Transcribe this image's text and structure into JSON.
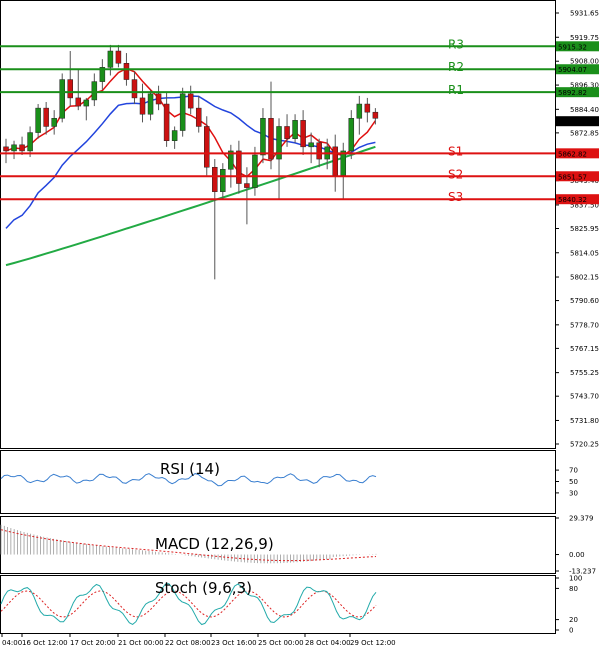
{
  "colors": {
    "resistance": "#1a8f1a",
    "support": "#dd1111",
    "bull_candle": "#1a8f1a",
    "bear_candle": "#cc1111",
    "ma_fast": "#e01010",
    "ma_mid": "#2244dd",
    "ma_slow": "#22aa44",
    "rsi": "#3a7fd0",
    "macd_signal": "#dd2222",
    "stoch_main": "#22aaaa",
    "stoch_signal": "#dd2222"
  },
  "price_axis": {
    "ylim": [
      5720.25,
      5931.65
    ],
    "ticks": [
      "5931.65",
      "5919.75",
      "5908.00",
      "5896.30",
      "5884.40",
      "5872.85",
      "5849.40",
      "5837.50",
      "5825.95",
      "5814.05",
      "5802.15",
      "5790.60",
      "5778.70",
      "5767.15",
      "5755.25",
      "5743.70",
      "5731.80",
      "5720.25"
    ],
    "tick_values": [
      5931.65,
      5919.75,
      5908.0,
      5896.3,
      5884.4,
      5872.85,
      5849.4,
      5837.5,
      5825.95,
      5814.05,
      5802.15,
      5790.6,
      5778.7,
      5767.15,
      5755.25,
      5743.7,
      5731.8,
      5720.25
    ],
    "current_price": "5878.58"
  },
  "levels": [
    {
      "name": "R3",
      "value": 5915.32,
      "tag": "5915.32",
      "kind": "resistance"
    },
    {
      "name": "R2",
      "value": 5904.07,
      "tag": "5904.07",
      "kind": "resistance"
    },
    {
      "name": "R1",
      "value": 5892.82,
      "tag": "5892.82",
      "kind": "resistance"
    },
    {
      "name": "S1",
      "value": 5862.82,
      "tag": "5862.82",
      "kind": "support"
    },
    {
      "name": "S2",
      "value": 5851.57,
      "tag": "5851.57",
      "kind": "support"
    },
    {
      "name": "S3",
      "value": 5840.32,
      "tag": "5840.32",
      "kind": "support"
    }
  ],
  "time_axis": [
    "04:00",
    "16 Oct 12:00",
    "17 Oct 20:00",
    "21 Oct 00:00",
    "22 Oct 08:00",
    "23 Oct 16:00",
    "25 Oct 00:00",
    "28 Oct 04:00",
    "29 Oct 12:00"
  ],
  "chart_data": {
    "type": "candlestick",
    "candles": [
      [
        5866,
        5870,
        5858,
        5864
      ],
      [
        5864,
        5869,
        5860,
        5867
      ],
      [
        5867,
        5871,
        5862,
        5864
      ],
      [
        5864,
        5876,
        5861,
        5873
      ],
      [
        5873,
        5887,
        5870,
        5885
      ],
      [
        5885,
        5888,
        5872,
        5876
      ],
      [
        5876,
        5884,
        5872,
        5880
      ],
      [
        5880,
        5902,
        5878,
        5899
      ],
      [
        5899,
        5913,
        5886,
        5890
      ],
      [
        5890,
        5904,
        5884,
        5886
      ],
      [
        5886,
        5890,
        5879,
        5889
      ],
      [
        5889,
        5902,
        5886,
        5898
      ],
      [
        5898,
        5909,
        5894,
        5905
      ],
      [
        5905,
        5916,
        5901,
        5913
      ],
      [
        5913,
        5916,
        5905,
        5907
      ],
      [
        5907,
        5912,
        5896,
        5899
      ],
      [
        5899,
        5903,
        5887,
        5890
      ],
      [
        5890,
        5897,
        5878,
        5882
      ],
      [
        5882,
        5894,
        5879,
        5892
      ],
      [
        5892,
        5896,
        5884,
        5887
      ],
      [
        5887,
        5893,
        5866,
        5869
      ],
      [
        5869,
        5876,
        5865,
        5874
      ],
      [
        5874,
        5895,
        5871,
        5892
      ],
      [
        5892,
        5896,
        5882,
        5885
      ],
      [
        5885,
        5891,
        5873,
        5876
      ],
      [
        5876,
        5881,
        5852,
        5856
      ],
      [
        5856,
        5860,
        5801,
        5844
      ],
      [
        5844,
        5858,
        5840,
        5855
      ],
      [
        5855,
        5867,
        5846,
        5864
      ],
      [
        5864,
        5869,
        5843,
        5848
      ],
      [
        5848,
        5856,
        5828,
        5846
      ],
      [
        5846,
        5866,
        5842,
        5862
      ],
      [
        5862,
        5885,
        5858,
        5880
      ],
      [
        5880,
        5898,
        5855,
        5860
      ],
      [
        5860,
        5880,
        5840,
        5876
      ],
      [
        5876,
        5882,
        5866,
        5870
      ],
      [
        5870,
        5882,
        5868,
        5879
      ],
      [
        5879,
        5884,
        5862,
        5866
      ],
      [
        5866,
        5873,
        5858,
        5868
      ],
      [
        5868,
        5870,
        5856,
        5860
      ],
      [
        5860,
        5870,
        5855,
        5866
      ],
      [
        5866,
        5872,
        5844,
        5852
      ],
      [
        5852,
        5868,
        5840,
        5864
      ],
      [
        5864,
        5884,
        5860,
        5880
      ],
      [
        5880,
        5891,
        5872,
        5887
      ],
      [
        5887,
        5890,
        5878,
        5883
      ],
      [
        5883,
        5885,
        5877,
        5880
      ]
    ],
    "rsi": {
      "period": 14,
      "ylim": [
        0,
        100
      ],
      "ticks": [
        70,
        50,
        30
      ]
    },
    "macd": {
      "params": "12,26,9",
      "ylim": [
        -13.237,
        29.379
      ],
      "ticks": [
        "29.379",
        "0.00",
        "-13.237"
      ]
    },
    "stoch": {
      "params": "9,6,3",
      "ylim": [
        0,
        100
      ],
      "ticks": [
        100,
        80,
        20,
        0
      ]
    }
  },
  "panels": {
    "rsi_title": "RSI (14)",
    "macd_title": "MACD (12,26,9)",
    "stoch_title": "Stoch (9,6,3)"
  }
}
